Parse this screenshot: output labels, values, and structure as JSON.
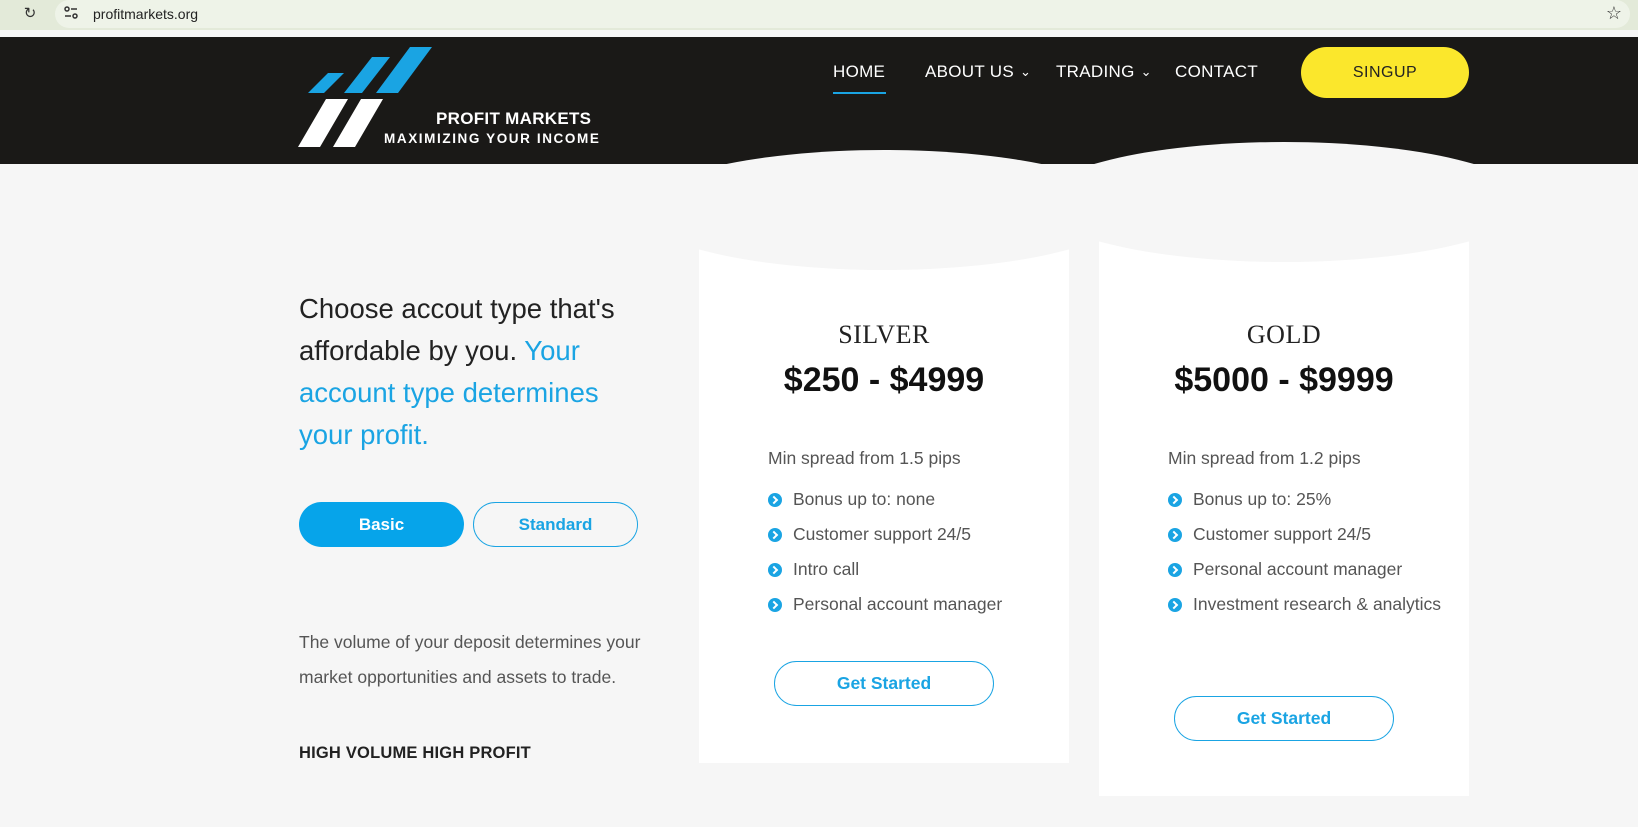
{
  "browser": {
    "url": "profitmarkets.org"
  },
  "brand": {
    "name": "PROFIT MARKETS",
    "tagline": "MAXIMIZING YOUR INCOME",
    "colors": {
      "accent": "#1aa4e3",
      "header_bg": "#1a1917",
      "signup_bg": "#fbe72c"
    }
  },
  "nav": {
    "home": "HOME",
    "about": "ABOUT US",
    "trading": "TRADING",
    "contact": "CONTACT",
    "signup": "SINGUP"
  },
  "intro": {
    "headline_plain": "Choose accout type that's affordable by you.",
    "headline_accent": "Your account type determines your profit.",
    "basic_label": "Basic",
    "standard_label": "Standard",
    "volume_text": "The volume of your deposit determines your market opportunities and assets to trade.",
    "high_volume": "HIGH VOLUME HIGH PROFIT"
  },
  "plans": {
    "silver": {
      "tier": "SILVER",
      "price": "$250 - $4999",
      "spread": "Min spread from 1.5 pips",
      "features": [
        "Bonus up to: none",
        "Customer support 24/5",
        "Intro call",
        "Personal account manager"
      ],
      "cta": "Get Started"
    },
    "gold": {
      "tier": "GOLD",
      "price": "$5000 - $9999",
      "spread": "Min spread from 1.2 pips",
      "features": [
        "Bonus up to: 25%",
        "Customer support 24/5",
        "Personal account manager",
        "Investment research & analytics"
      ],
      "cta": "Get Started"
    }
  }
}
